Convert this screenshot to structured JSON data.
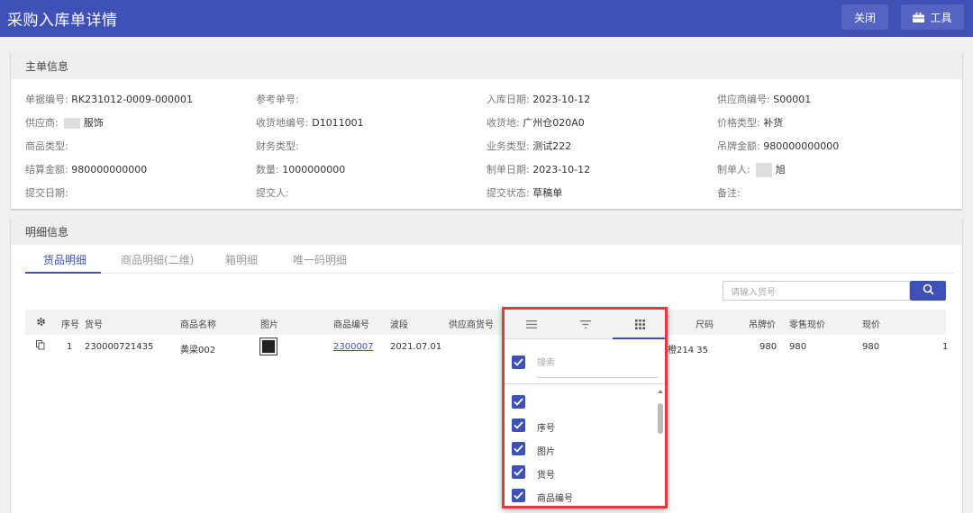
{
  "header": {
    "title": "采购入库单详情",
    "close_label": "关闭",
    "tools_label": "工具"
  },
  "main_info": {
    "section_title": "主单信息",
    "fields": [
      {
        "label": "单据编号:",
        "value": "RK231012-0009-000001"
      },
      {
        "label": "参考单号:",
        "value": ""
      },
      {
        "label": "入库日期:",
        "value": "2023-10-12"
      },
      {
        "label": "供应商编号:",
        "value": "S00001"
      },
      {
        "label": "供应商:",
        "value": "服饰"
      },
      {
        "label": "收货地编号:",
        "value": "D1011001"
      },
      {
        "label": "收货地:",
        "value": "广州仓020A0"
      },
      {
        "label": "价格类型:",
        "value": "补货"
      },
      {
        "label": "商品类型:",
        "value": ""
      },
      {
        "label": "财务类型:",
        "value": ""
      },
      {
        "label": "业务类型:",
        "value": "测试222"
      },
      {
        "label": "吊牌金额:",
        "value": "980000000000"
      },
      {
        "label": "结算金额:",
        "value": "980000000000"
      },
      {
        "label": "数量:",
        "value": "1000000000"
      },
      {
        "label": "制单日期:",
        "value": "2023-10-12"
      },
      {
        "label": "制单人:",
        "value": "旭"
      },
      {
        "label": "提交日期:",
        "value": ""
      },
      {
        "label": "提交人:",
        "value": ""
      },
      {
        "label": "提交状态:",
        "value": "草稿单"
      },
      {
        "label": "备注:",
        "value": ""
      }
    ]
  },
  "detail": {
    "section_title": "明细信息",
    "tabs": [
      "货品明细",
      "商品明细(二维)",
      "箱明细",
      "唯一码明细"
    ],
    "search_placeholder": "请输入货号",
    "columns": [
      "序号",
      "货号",
      "商品名称",
      "图片",
      "商品编号",
      "波段",
      "供应商货号",
      "尺码",
      "吊牌价",
      "零售现价",
      "现价"
    ],
    "row": {
      "index": "1",
      "item_no": "230000721435",
      "name": "黄梁002",
      "code": "2300007",
      "band": "2021.07.01",
      "size": "橙214 35",
      "tag_price": "980",
      "retail_price": "980",
      "price": "980",
      "overflow": "1"
    }
  },
  "column_popup": {
    "search_placeholder": "搜索",
    "items": [
      "",
      "序号",
      "图片",
      "货号",
      "商品编号"
    ]
  },
  "colors": {
    "primary": "#3f51b5",
    "highlight_border": "#e53935"
  }
}
